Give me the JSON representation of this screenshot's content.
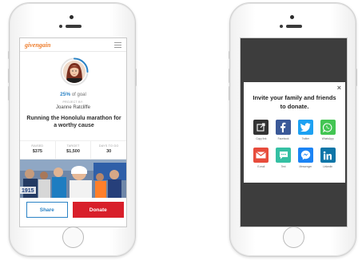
{
  "left_phone": {
    "header": {
      "logo": "givengain"
    },
    "progress": {
      "percent_text": "25%",
      "suffix": " of goal",
      "fraction": 0.25
    },
    "project_by_label": "PROJECT BY:",
    "owner_name": "Joanne Ratcliffe",
    "title": "Running the Honolulu marathon for a worthy cause",
    "stats": [
      {
        "label": "RAISED",
        "value": "$375"
      },
      {
        "label": "TARGET",
        "value": "$1,500"
      },
      {
        "label": "DAYS TO GO",
        "value": "30"
      }
    ],
    "photo_bib": "1915",
    "buttons": {
      "share": "Share",
      "donate": "Donate"
    }
  },
  "right_phone": {
    "modal": {
      "close": "×",
      "heading": "Invite your family and friends to donate.",
      "items": [
        {
          "label": "Copy link",
          "icon": "copy-link-icon",
          "color": "#333333"
        },
        {
          "label": "Facebook",
          "icon": "facebook-icon",
          "color": "#3b5998"
        },
        {
          "label": "Twitter",
          "icon": "twitter-icon",
          "color": "#1da1f2"
        },
        {
          "label": "WhatsApp",
          "icon": "whatsapp-icon",
          "color": "#43c553"
        },
        {
          "label": "E-mail",
          "icon": "email-icon",
          "color": "#e74c3c"
        },
        {
          "label": "Text",
          "icon": "text-message-icon",
          "color": "#35c0a3"
        },
        {
          "label": "Messenger",
          "icon": "messenger-icon",
          "color": "#1b84f5"
        },
        {
          "label": "LinkedIn",
          "icon": "linkedin-icon",
          "color": "#0e76a8"
        }
      ]
    }
  },
  "colors": {
    "accent_blue": "#2b83c6",
    "donate_red": "#d81f2a",
    "logo_orange": "#ee7d2c",
    "overlay": "#3d3d3d"
  }
}
